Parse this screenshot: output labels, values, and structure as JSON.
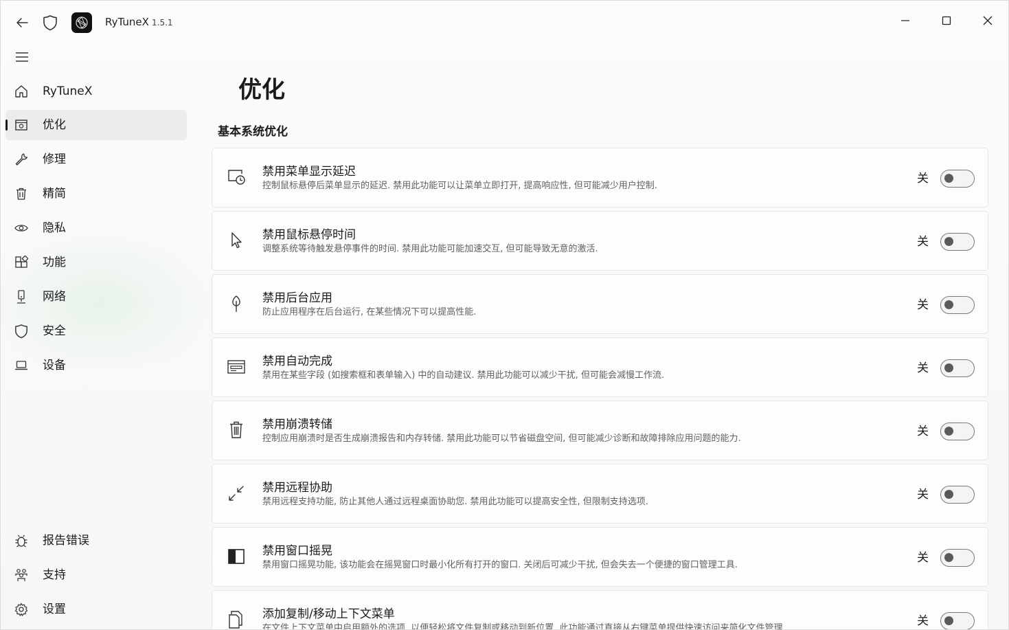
{
  "app": {
    "title": "RyTuneX",
    "version": "1.5.1"
  },
  "nav": {
    "items": [
      {
        "id": "home",
        "label": "RyTuneX",
        "icon": "home-icon"
      },
      {
        "id": "optimize",
        "label": "优化",
        "icon": "optimize-icon",
        "selected": true
      },
      {
        "id": "repair",
        "label": "修理",
        "icon": "wrench-icon"
      },
      {
        "id": "debloat",
        "label": "精简",
        "icon": "trash-icon"
      },
      {
        "id": "privacy",
        "label": "隐私",
        "icon": "eye-icon"
      },
      {
        "id": "features",
        "label": "功能",
        "icon": "apps-icon"
      },
      {
        "id": "network",
        "label": "网络",
        "icon": "network-tower-icon"
      },
      {
        "id": "security",
        "label": "安全",
        "icon": "shield-icon"
      },
      {
        "id": "devices",
        "label": "设备",
        "icon": "laptop-icon"
      }
    ],
    "footer": [
      {
        "id": "report-bug",
        "label": "报告错误",
        "icon": "bug-icon"
      },
      {
        "id": "support",
        "label": "支持",
        "icon": "people-icon"
      },
      {
        "id": "settings",
        "label": "设置",
        "icon": "gear-icon"
      }
    ]
  },
  "page": {
    "title": "优化",
    "section": "基本系统优化"
  },
  "cards": [
    {
      "title": "禁用菜单显示延迟",
      "desc": "控制鼠标悬停后菜单显示的延迟. 禁用此功能可以让菜单立即打开, 提高响应性, 但可能减少用户控制.",
      "state": "关",
      "icon": "menu-clock-icon"
    },
    {
      "title": "禁用鼠标悬停时间",
      "desc": "调整系统等待触发悬停事件的时间. 禁用此功能可能加速交互, 但可能导致无意的激活.",
      "state": "关",
      "icon": "cursor-icon"
    },
    {
      "title": "禁用后台应用",
      "desc": "防止应用程序在后台运行, 在某些情况下可以提高性能.",
      "state": "关",
      "icon": "pin-icon"
    },
    {
      "title": "禁用自动完成",
      "desc": "禁用在某些字段 (如搜索框和表单输入) 中的自动建议. 禁用此功能可以减少干扰, 但可能会减慢工作流.",
      "state": "关",
      "icon": "form-icon"
    },
    {
      "title": "禁用崩溃转储",
      "desc": "控制应用崩溃时是否生成崩溃报告和内存转储. 禁用此功能可以节省磁盘空间, 但可能减少诊断和故障排除应用问题的能力.",
      "state": "关",
      "icon": "trash-icon"
    },
    {
      "title": "禁用远程协助",
      "desc": "禁用远程支持功能, 防止其他人通过远程桌面协助您. 禁用此功能可以提高安全性, 但限制支持选项.",
      "state": "关",
      "icon": "remote-arrows-icon"
    },
    {
      "title": "禁用窗口摇晃",
      "desc": "禁用窗口摇晃功能, 该功能会在摇晃窗口时最小化所有打开的窗口. 关闭后可减少干扰, 但会失去一个便捷的窗口管理工具.",
      "state": "关",
      "icon": "window-half-icon"
    },
    {
      "title": "添加复制/移动上下文菜单",
      "desc": "在文件上下文菜单中启用额外的选项, 以便轻松将文件复制或移动到新位置. 此功能通过直接从右键菜单提供快速访问来简化文件管理.",
      "state": "关",
      "icon": "copy-icon"
    }
  ]
}
